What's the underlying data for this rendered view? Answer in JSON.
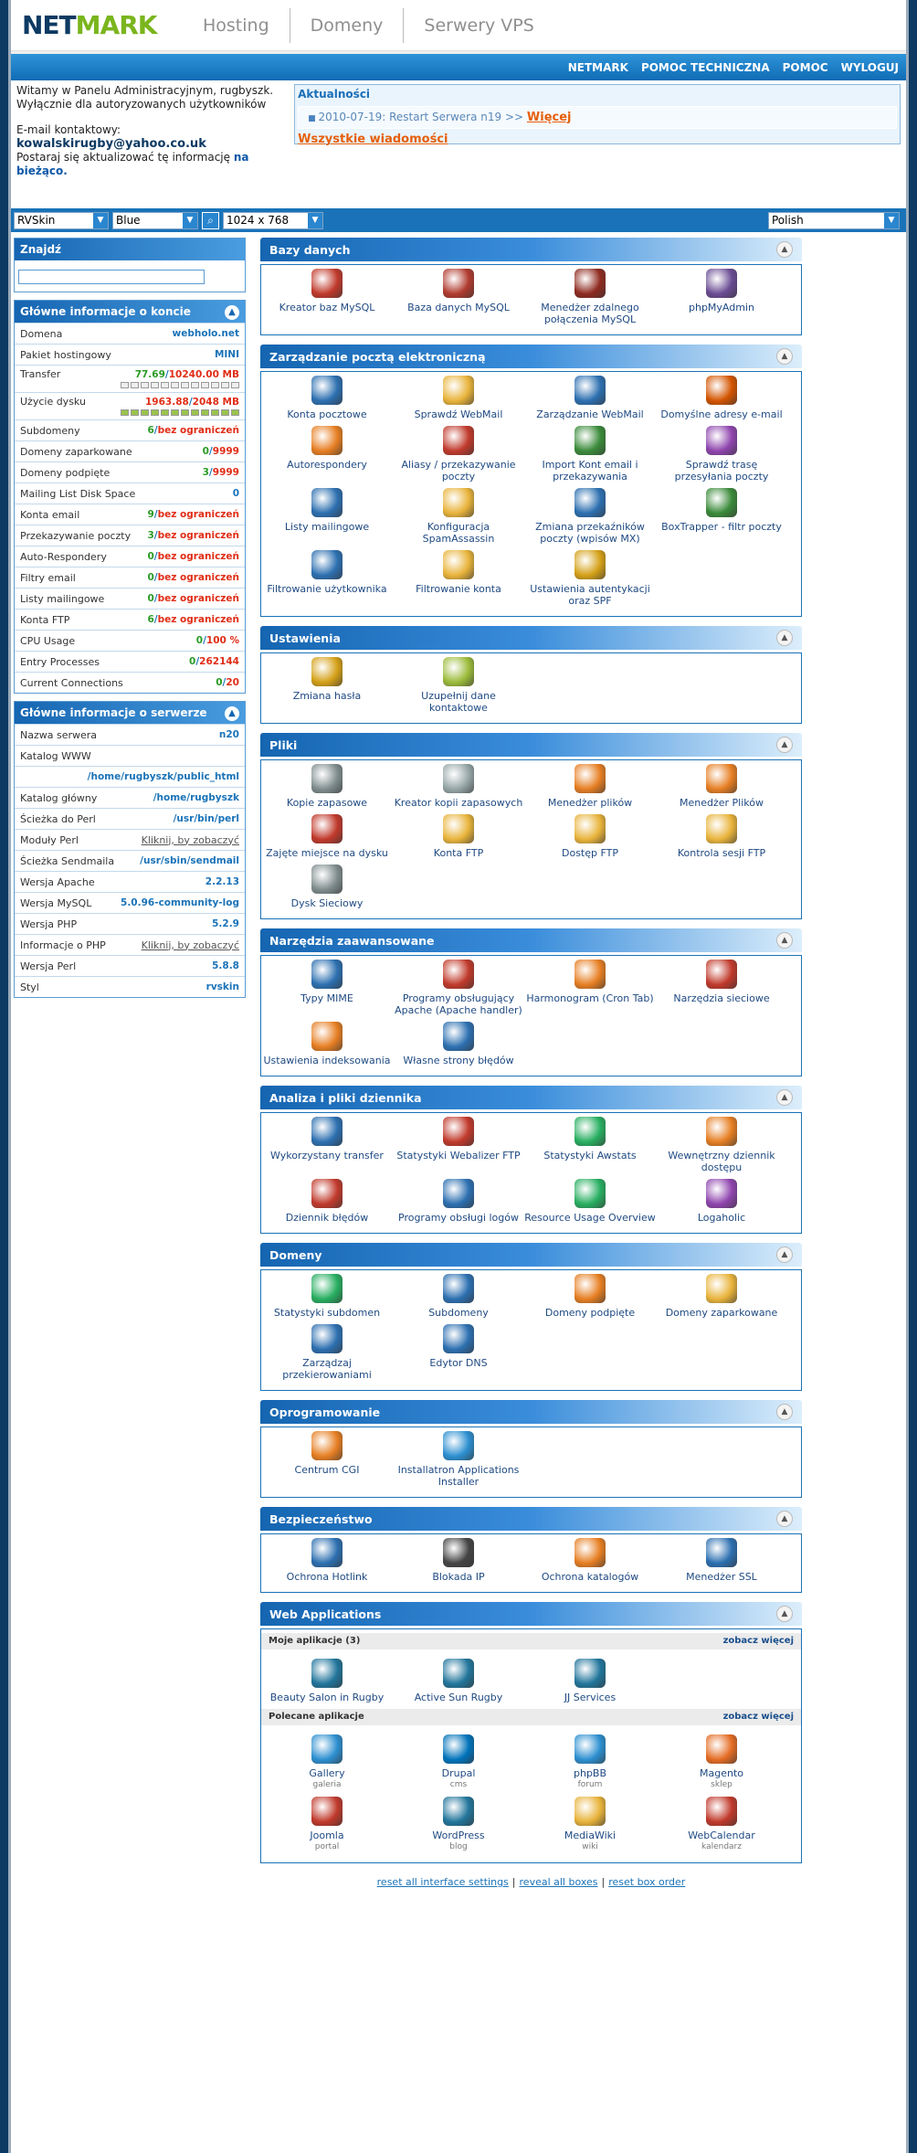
{
  "header": {
    "logo": {
      "net": "NET",
      "mark": "MARK"
    },
    "nav": [
      "Hosting",
      "Domeny",
      "Serwery VPS"
    ],
    "menu": [
      "NETMARK",
      "POMOC TECHNICZNA",
      "POMOC",
      "WYLOGUJ"
    ]
  },
  "welcome": {
    "line1": "Witamy w Panelu Administracyjnym, rugbyszk.",
    "line2": "Wyłącznie dla autoryzowanych użytkowników",
    "email_label": "E-mail kontaktowy:",
    "email": "kowalskirugby@yahoo.co.uk",
    "update_text": "Postaraj się aktualizować tę informację",
    "update_link": "na bieżąco."
  },
  "news": {
    "title": "Aktualności",
    "item": "2010-07-19: Restart Serwera n19 >>",
    "more": "Więcej",
    "all": "Wszystkie wiadomości"
  },
  "selects": {
    "skin": "RVSkin",
    "color": "Blue",
    "resolution": "1024 x 768",
    "language": "Polish"
  },
  "colors": {
    "accent": "#1a73b8",
    "green": "#2a9b24",
    "red": "#e02d16",
    "orange": "#e65f0a"
  },
  "find": {
    "title": "Znajdź"
  },
  "account": {
    "title": "Główne informacje o koncie",
    "domain": {
      "label": "Domena",
      "value": "webholo.net"
    },
    "package": {
      "label": "Pakiet hostingowy",
      "value": "MINI"
    },
    "transfer": {
      "label": "Transfer",
      "used": "77.69",
      "max": "10240.00 MB",
      "fraction": 0.0076
    },
    "disk": {
      "label": "Użycie dysku",
      "used": "1963.88",
      "max": "2048 MB",
      "fraction": 0.959
    },
    "rows": [
      {
        "label": "Subdomeny",
        "used": "6",
        "max": "bez ograniczeń"
      },
      {
        "label": "Domeny zaparkowane",
        "used": "0",
        "max": "9999"
      },
      {
        "label": "Domeny podpięte",
        "used": "3",
        "max": "9999"
      },
      {
        "label": "Mailing List Disk Space",
        "used": "0",
        "max": ""
      },
      {
        "label": "Konta email",
        "used": "9",
        "max": "bez ograniczeń"
      },
      {
        "label": "Przekazywanie poczty",
        "used": "3",
        "max": "bez ograniczeń"
      },
      {
        "label": "Auto-Respondery",
        "used": "0",
        "max": "bez ograniczeń"
      },
      {
        "label": "Filtry email",
        "used": "0",
        "max": "bez ograniczeń"
      },
      {
        "label": "Listy mailingowe",
        "used": "0",
        "max": "bez ograniczeń"
      },
      {
        "label": "Konta FTP",
        "used": "6",
        "max": "bez ograniczeń"
      },
      {
        "label": "CPU Usage",
        "used": "0",
        "max": "100 %"
      },
      {
        "label": "Entry Processes",
        "used": "0",
        "max": "262144"
      },
      {
        "label": "Current Connections",
        "used": "0",
        "max": "20"
      }
    ]
  },
  "server": {
    "title": "Główne informacje o serwerze",
    "rows": [
      {
        "label": "Nazwa serwera",
        "value": "n20"
      },
      {
        "label": "Katalog WWW",
        "value": ""
      },
      {
        "label": "",
        "value": "/home/rugbyszk/public_html"
      },
      {
        "label": "Katalog główny",
        "value": "/home/rugbyszk"
      },
      {
        "label": "Ścieżka do Perl",
        "value": "/usr/bin/perl"
      },
      {
        "label": "Moduły Perl",
        "value": "Kliknij, by zobaczyć",
        "link": true
      },
      {
        "label": "Ścieżka Sendmaila",
        "value": "/usr/sbin/sendmail"
      },
      {
        "label": "Wersja Apache",
        "value": "2.2.13"
      },
      {
        "label": "Wersja MySQL",
        "value": "5.0.96-community-log"
      },
      {
        "label": "Wersja PHP",
        "value": "5.2.9"
      },
      {
        "label": "Informacje o PHP",
        "value": "Kliknij, by zobaczyć",
        "link": true
      },
      {
        "label": "Wersja Perl",
        "value": "5.8.8"
      },
      {
        "label": "Styl",
        "value": "rvskin"
      }
    ]
  },
  "panels": [
    {
      "title": "Bazy danych",
      "items": [
        {
          "label": "Kreator baz MySQL",
          "icon": "mysql-wizard-icon",
          "color": "#c0392b"
        },
        {
          "label": "Baza danych MySQL",
          "icon": "mysql-icon",
          "color": "#b03a2e"
        },
        {
          "label": "Menedżer zdalnego połączenia MySQL",
          "icon": "remote-mysql-icon",
          "color": "#8e2a20"
        },
        {
          "label": "phpMyAdmin",
          "icon": "phpmyadmin-icon",
          "color": "#6a4c93"
        }
      ]
    },
    {
      "title": "Zarządzanie pocztą elektroniczną",
      "items": [
        {
          "label": "Konta pocztowe",
          "icon": "mail-accounts-icon",
          "color": "#2c6fb0"
        },
        {
          "label": "Sprawdź WebMail",
          "icon": "webmail-icon",
          "color": "#e8b33a"
        },
        {
          "label": "Zarządzanie WebMail",
          "icon": "webmail-manage-icon",
          "color": "#2c6fb0"
        },
        {
          "label": "Domyślne adresy e-mail",
          "icon": "default-address-icon",
          "color": "#d35400"
        },
        {
          "label": "Autorespondery",
          "icon": "autoresponder-icon",
          "color": "#e67e22"
        },
        {
          "label": "Aliasy / przekazywanie poczty",
          "icon": "forwarders-icon",
          "color": "#c0392b"
        },
        {
          "label": "Import Kont email i przekazywania",
          "icon": "import-icon",
          "color": "#3a8a3a"
        },
        {
          "label": "Sprawdź trasę przesyłania poczty",
          "icon": "trace-icon",
          "color": "#8e44ad"
        },
        {
          "label": "Listy mailingowe",
          "icon": "mailing-lists-icon",
          "color": "#2c6fb0"
        },
        {
          "label": "Konfiguracja SpamAssassin",
          "icon": "spamassassin-icon",
          "color": "#e8b33a"
        },
        {
          "label": "Zmiana przekaźników poczty (wpisów MX)",
          "icon": "mx-icon",
          "color": "#2c6fb0"
        },
        {
          "label": "BoxTrapper - filtr poczty",
          "icon": "boxtrapper-icon",
          "color": "#3a8a3a"
        },
        {
          "label": "Filtrowanie użytkownika",
          "icon": "user-filter-icon",
          "color": "#2c6fb0"
        },
        {
          "label": "Filtrowanie konta",
          "icon": "account-filter-icon",
          "color": "#e8b33a"
        },
        {
          "label": "Ustawienia autentykacji oraz SPF",
          "icon": "spf-icon",
          "color": "#d4a017"
        }
      ]
    },
    {
      "title": "Ustawienia",
      "items": [
        {
          "label": "Zmiana hasła",
          "icon": "lock-icon",
          "color": "#d4a017"
        },
        {
          "label": "Uzupełnij dane kontaktowe",
          "icon": "contact-icon",
          "color": "#9bbb3a"
        }
      ]
    },
    {
      "title": "Pliki",
      "items": [
        {
          "label": "Kopie zapasowe",
          "icon": "backup-icon",
          "color": "#7f8c8d"
        },
        {
          "label": "Kreator kopii zapasowych",
          "icon": "backup-wizard-icon",
          "color": "#95a5a6"
        },
        {
          "label": "Menedżer plików",
          "icon": "file-manager-icon",
          "color": "#e67e22"
        },
        {
          "label": "Menedżer Plików",
          "icon": "file-manager-2-icon",
          "color": "#e67e22"
        },
        {
          "label": "Zajęte miejsce na dysku",
          "icon": "disk-usage-icon",
          "color": "#c0392b"
        },
        {
          "label": "Konta FTP",
          "icon": "ftp-accounts-icon",
          "color": "#e8b33a"
        },
        {
          "label": "Dostęp FTP",
          "icon": "ftp-access-icon",
          "color": "#e8b33a"
        },
        {
          "label": "Kontrola sesji FTP",
          "icon": "ftp-session-icon",
          "color": "#e8b33a"
        },
        {
          "label": "Dysk Sieciowy",
          "icon": "network-disk-icon",
          "color": "#7f8c8d"
        }
      ]
    },
    {
      "title": "Narzędzia zaawansowane",
      "items": [
        {
          "label": "Typy MIME",
          "icon": "mime-icon",
          "color": "#2c6fb0"
        },
        {
          "label": "Programy obsługujący Apache (Apache handler)",
          "icon": "apache-handler-icon",
          "color": "#c0392b"
        },
        {
          "label": "Harmonogram (Cron Tab)",
          "icon": "cron-icon",
          "color": "#e67e22"
        },
        {
          "label": "Narzędzia sieciowe",
          "icon": "network-tools-icon",
          "color": "#c0392b"
        },
        {
          "label": "Ustawienia indeksowania",
          "icon": "indexes-icon",
          "color": "#e67e22"
        },
        {
          "label": "Własne strony błędów",
          "icon": "error-pages-icon",
          "color": "#2c6fb0"
        }
      ]
    },
    {
      "title": "Analiza i pliki dziennika",
      "items": [
        {
          "label": "Wykorzystany transfer",
          "icon": "bandwidth-icon",
          "color": "#2c6fb0"
        },
        {
          "label": "Statystyki Webalizer FTP",
          "icon": "webalizer-icon",
          "color": "#c0392b"
        },
        {
          "label": "Statystyki Awstats",
          "icon": "awstats-icon",
          "color": "#27ae60"
        },
        {
          "label": "Wewnętrzny dziennik dostępu",
          "icon": "raw-log-icon",
          "color": "#e67e22"
        },
        {
          "label": "Dziennik błędów",
          "icon": "error-log-icon",
          "color": "#c0392b"
        },
        {
          "label": "Programy obsługi logów",
          "icon": "log-programs-icon",
          "color": "#2c6fb0"
        },
        {
          "label": "Resource Usage Overview",
          "icon": "resource-usage-icon",
          "color": "#27ae60"
        },
        {
          "label": "Logaholic",
          "icon": "logaholic-icon",
          "color": "#8e44ad"
        }
      ]
    },
    {
      "title": "Domeny",
      "items": [
        {
          "label": "Statystyki subdomen",
          "icon": "subdomain-stats-icon",
          "color": "#27ae60"
        },
        {
          "label": "Subdomeny",
          "icon": "subdomains-icon",
          "color": "#2c6fb0"
        },
        {
          "label": "Domeny podpięte",
          "icon": "addon-domains-icon",
          "color": "#e67e22"
        },
        {
          "label": "Domeny zaparkowane",
          "icon": "parked-domains-icon",
          "color": "#e8b33a"
        },
        {
          "label": "Zarządzaj przekierowaniami",
          "icon": "redirects-icon",
          "color": "#2c6fb0"
        },
        {
          "label": "Edytor DNS",
          "icon": "dns-icon",
          "color": "#2c6fb0"
        }
      ]
    },
    {
      "title": "Oprogramowanie",
      "items": [
        {
          "label": "Centrum CGI",
          "icon": "cgi-icon",
          "color": "#e67e22"
        },
        {
          "label": "Installatron Applications Installer",
          "icon": "installatron-icon",
          "color": "#2c8fd0"
        }
      ]
    },
    {
      "title": "Bezpieczeństwo",
      "items": [
        {
          "label": "Ochrona Hotlink",
          "icon": "hotlink-icon",
          "color": "#2c6fb0"
        },
        {
          "label": "Blokada IP",
          "icon": "ip-deny-icon",
          "color": "#444444"
        },
        {
          "label": "Ochrona katalogów",
          "icon": "password-dir-icon",
          "color": "#e67e22"
        },
        {
          "label": "Menedżer SSL",
          "icon": "ssl-icon",
          "color": "#2c6fb0"
        }
      ]
    }
  ],
  "webapps": {
    "title": "Web Applications",
    "mine_label": "Moje aplikacje (3)",
    "see_more": "zobacz więcej",
    "mine": [
      {
        "label": "Beauty Salon in Rugby",
        "icon": "wordpress-icon",
        "color": "#21759b"
      },
      {
        "label": "Active Sun Rugby",
        "icon": "wordpress-icon",
        "color": "#21759b"
      },
      {
        "label": "JJ Services",
        "icon": "wordpress-icon",
        "color": "#21759b"
      }
    ],
    "recommended_label": "Polecane aplikacje",
    "recommended": [
      {
        "label": "Gallery",
        "sub": "galeria",
        "icon": "gallery-icon",
        "color": "#2c8fd0"
      },
      {
        "label": "Drupal",
        "sub": "cms",
        "icon": "drupal-icon",
        "color": "#0073ba"
      },
      {
        "label": "phpBB",
        "sub": "forum",
        "icon": "phpbb-icon",
        "color": "#2c8fd0"
      },
      {
        "label": "Magento",
        "sub": "sklep",
        "icon": "magento-icon",
        "color": "#e46b23"
      },
      {
        "label": "Joomla",
        "sub": "portal",
        "icon": "joomla-icon",
        "color": "#c0392b"
      },
      {
        "label": "WordPress",
        "sub": "blog",
        "icon": "wordpress-icon",
        "color": "#21759b"
      },
      {
        "label": "MediaWiki",
        "sub": "wiki",
        "icon": "mediawiki-icon",
        "color": "#e8b33a"
      },
      {
        "label": "WebCalendar",
        "sub": "kalendarz",
        "icon": "calendar-icon",
        "color": "#c0392b"
      }
    ]
  },
  "footer": [
    "reset all interface settings",
    "reveal all boxes",
    "reset box order"
  ]
}
